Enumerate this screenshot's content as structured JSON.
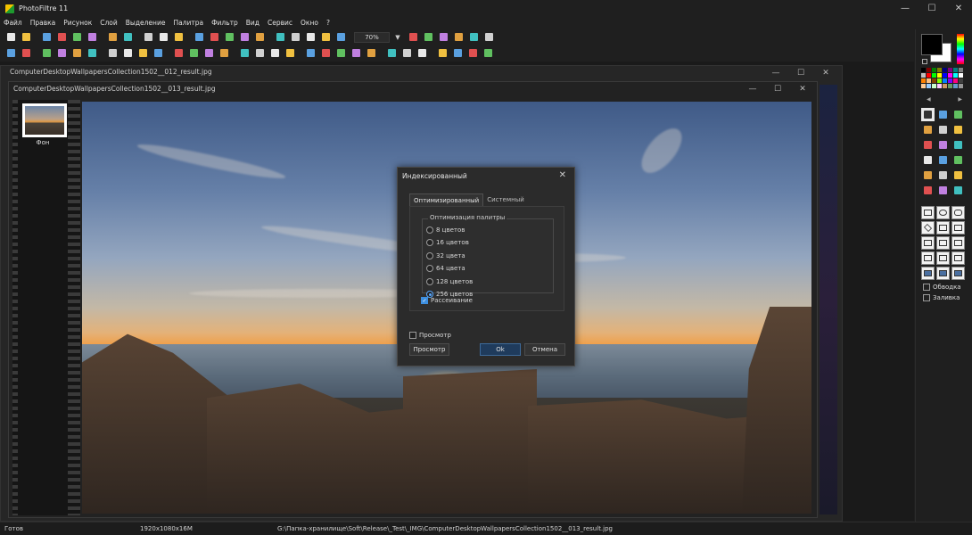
{
  "app": {
    "title": "PhotoFiltre 11",
    "window_controls": {
      "minimize": "—",
      "maximize": "☐",
      "close": "✕"
    }
  },
  "menu": [
    "Файл",
    "Правка",
    "Рисунок",
    "Слой",
    "Выделение",
    "Палитра",
    "Фильтр",
    "Вид",
    "Сервис",
    "Окно",
    "?"
  ],
  "toolbar1": {
    "zoom_value": "70%",
    "icons": [
      "new-icon",
      "open-icon",
      "save-icon",
      "save-as-icon",
      "print-icon",
      "scan-icon",
      "undo-icon",
      "redo-icon",
      "cut-icon",
      "copy-icon",
      "paste-icon",
      "image-size-icon",
      "canvas-size-icon",
      "crop-icon",
      "export-icon",
      "info-icon",
      "transparency-icon",
      "color-icon",
      "magic-icon",
      "autocolor-icon",
      "select-all-icon"
    ],
    "zoom_icons": [
      "zoom-in-icon",
      "zoom-out-icon",
      "fit-width-icon",
      "fit-height-icon",
      "fit-screen-icon",
      "fullscreen-icon"
    ]
  },
  "toolbar2": {
    "icons": [
      "dot-icon",
      "blob-icon",
      "arrow-icon",
      "arrow-2-icon",
      "text-t-icon",
      "text-t2-icon",
      "rgb-icon",
      "rgb-2-icon",
      "gradient-icon",
      "gradient-2-icon",
      "contrast-icon",
      "hue-icon",
      "sharpen-icon",
      "blur-icon",
      "frame-icon",
      "frame-2-icon",
      "level-icon",
      "fill-icon",
      "drop-icon",
      "drop-2-icon",
      "mountain-icon",
      "mountain-2-icon",
      "mountain-3-icon",
      "palette-icon",
      "image-icon",
      "image-2-icon",
      "flip-h-icon",
      "flip-v-icon",
      "rotate-icon",
      "rotate-2-icon"
    ]
  },
  "background_doc": {
    "title": "ComputerDesktopWallpapersCollection1502__012_result.jpg"
  },
  "doc": {
    "title": "ComputerDesktopWallpapersCollection1502__013_result.jpg",
    "layer_name": "Фон"
  },
  "dialog": {
    "title": "Индексированный",
    "close": "✕",
    "tabs": [
      {
        "label": "Оптимизированный",
        "active": true
      },
      {
        "label": "Системный",
        "active": false
      }
    ],
    "group_label": "Оптимизация палитры",
    "options": [
      {
        "label": "8 цветов",
        "checked": false
      },
      {
        "label": "16 цветов",
        "checked": false
      },
      {
        "label": "32 цвета",
        "checked": false
      },
      {
        "label": "64 цвета",
        "checked": false
      },
      {
        "label": "128 цветов",
        "checked": false
      },
      {
        "label": "256 цветов",
        "checked": true
      }
    ],
    "dither_label": "Рассеивание",
    "dither_checked": true,
    "preview_checkbox_label": "Просмотр",
    "preview_checked": false,
    "preview_button": "Просмотр",
    "ok_button": "Ok",
    "cancel_button": "Отмена"
  },
  "right_panel": {
    "foreground_color": "#000000",
    "background_color": "#ffffff",
    "palette_colors": [
      "#000000",
      "#800000",
      "#008000",
      "#808000",
      "#000080",
      "#800080",
      "#008080",
      "#808080",
      "#c0c0c0",
      "#ff0000",
      "#00ff00",
      "#ffff00",
      "#0000ff",
      "#ff00ff",
      "#00ffff",
      "#ffffff",
      "#ff8000",
      "#ffc080",
      "#804000",
      "#80ff00",
      "#0080ff",
      "#8000ff",
      "#ff0080",
      "#404040",
      "#ffcc99",
      "#99ccff",
      "#ccffcc",
      "#ffccff",
      "#cc9966",
      "#669966",
      "#6699cc",
      "#999999"
    ],
    "tools": [
      "selection-arrow-icon",
      "picture-icon",
      "hand-icon",
      "pipette-icon",
      "line-icon",
      "brush-line-icon",
      "fill-bucket-icon",
      "spray-icon",
      "eraser-icon",
      "pencil-icon",
      "brush-icon",
      "stamp-icon",
      "drop-icon",
      "finger-icon",
      "brush-2-icon",
      "clone-icon",
      "magic-wand-icon",
      "heart-icon"
    ],
    "shapes": [
      "rect-shape-icon",
      "ellipse-shape-icon",
      "round-rect-shape-icon",
      "diamond-shape-icon",
      "triangle-shape-icon",
      "triangle-right-shape-icon",
      "lasso-shape-icon",
      "polygon-shape-icon",
      "folder-shape-icon",
      "select-shape-icon",
      "select-2-shape-icon",
      "select-3-shape-icon",
      "frame-shape-icon",
      "frame-2-shape-icon",
      "frame-3-shape-icon"
    ],
    "outline_label": "Обводка",
    "fill_label": "Заливка"
  },
  "status": {
    "state": "Готов",
    "dimensions": "1920x1080x16M",
    "path": "G:\\Папка-хранилище\\Soft\\Release\\_Test\\_IMG\\ComputerDesktopWallpapersCollection1502__013_result.jpg"
  }
}
